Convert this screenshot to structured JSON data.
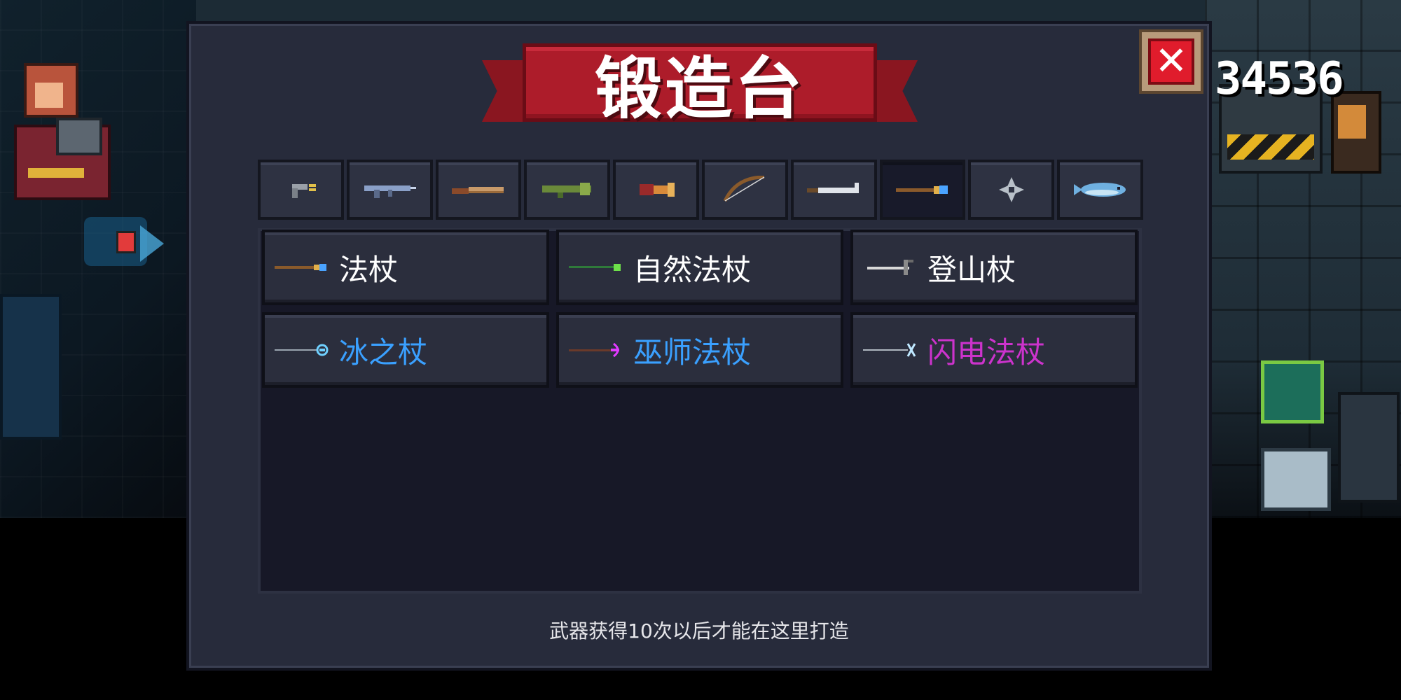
{
  "title": "锻造台",
  "close_label": "✕",
  "level_counter": "34536",
  "tabs": [
    {
      "icon": "pistol-icon",
      "active": false
    },
    {
      "icon": "rifle-icon",
      "active": false
    },
    {
      "icon": "shotgun-icon",
      "active": false
    },
    {
      "icon": "rocket-launcher-icon",
      "active": false
    },
    {
      "icon": "cannon-icon",
      "active": false
    },
    {
      "icon": "bow-icon",
      "active": false
    },
    {
      "icon": "sword-icon",
      "active": false
    },
    {
      "icon": "staff-icon",
      "active": true
    },
    {
      "icon": "throwing-star-icon",
      "active": false
    },
    {
      "icon": "fish-icon",
      "active": false
    }
  ],
  "items": [
    {
      "name": "法杖",
      "color": "#ffffff",
      "icon": "staff-icon",
      "tip": "#4aa3ff",
      "shaft": "#8a5a2b"
    },
    {
      "name": "自然法杖",
      "color": "#ffffff",
      "icon": "nature-staff-icon",
      "tip": "#6ee04a",
      "shaft": "#2f7a3a"
    },
    {
      "name": "登山杖",
      "color": "#ffffff",
      "icon": "pickaxe-icon",
      "tip": "#ffffff",
      "shaft": "#d8d8d8"
    },
    {
      "name": "冰之杖",
      "color": "#3aa0ff",
      "icon": "ice-staff-icon",
      "tip": "#6fd0ff",
      "shaft": "#9aa4b0"
    },
    {
      "name": "巫师法杖",
      "color": "#3aa0ff",
      "icon": "wizard-staff-icon",
      "tip": "#e13aff",
      "shaft": "#6a3a2a"
    },
    {
      "name": "闪电法杖",
      "color": "#cc33cc",
      "icon": "lightning-staff-icon",
      "tip": "#bfe8ff",
      "shaft": "#b0b8c0"
    }
  ],
  "hint": "武器获得10次以后才能在这里打造"
}
